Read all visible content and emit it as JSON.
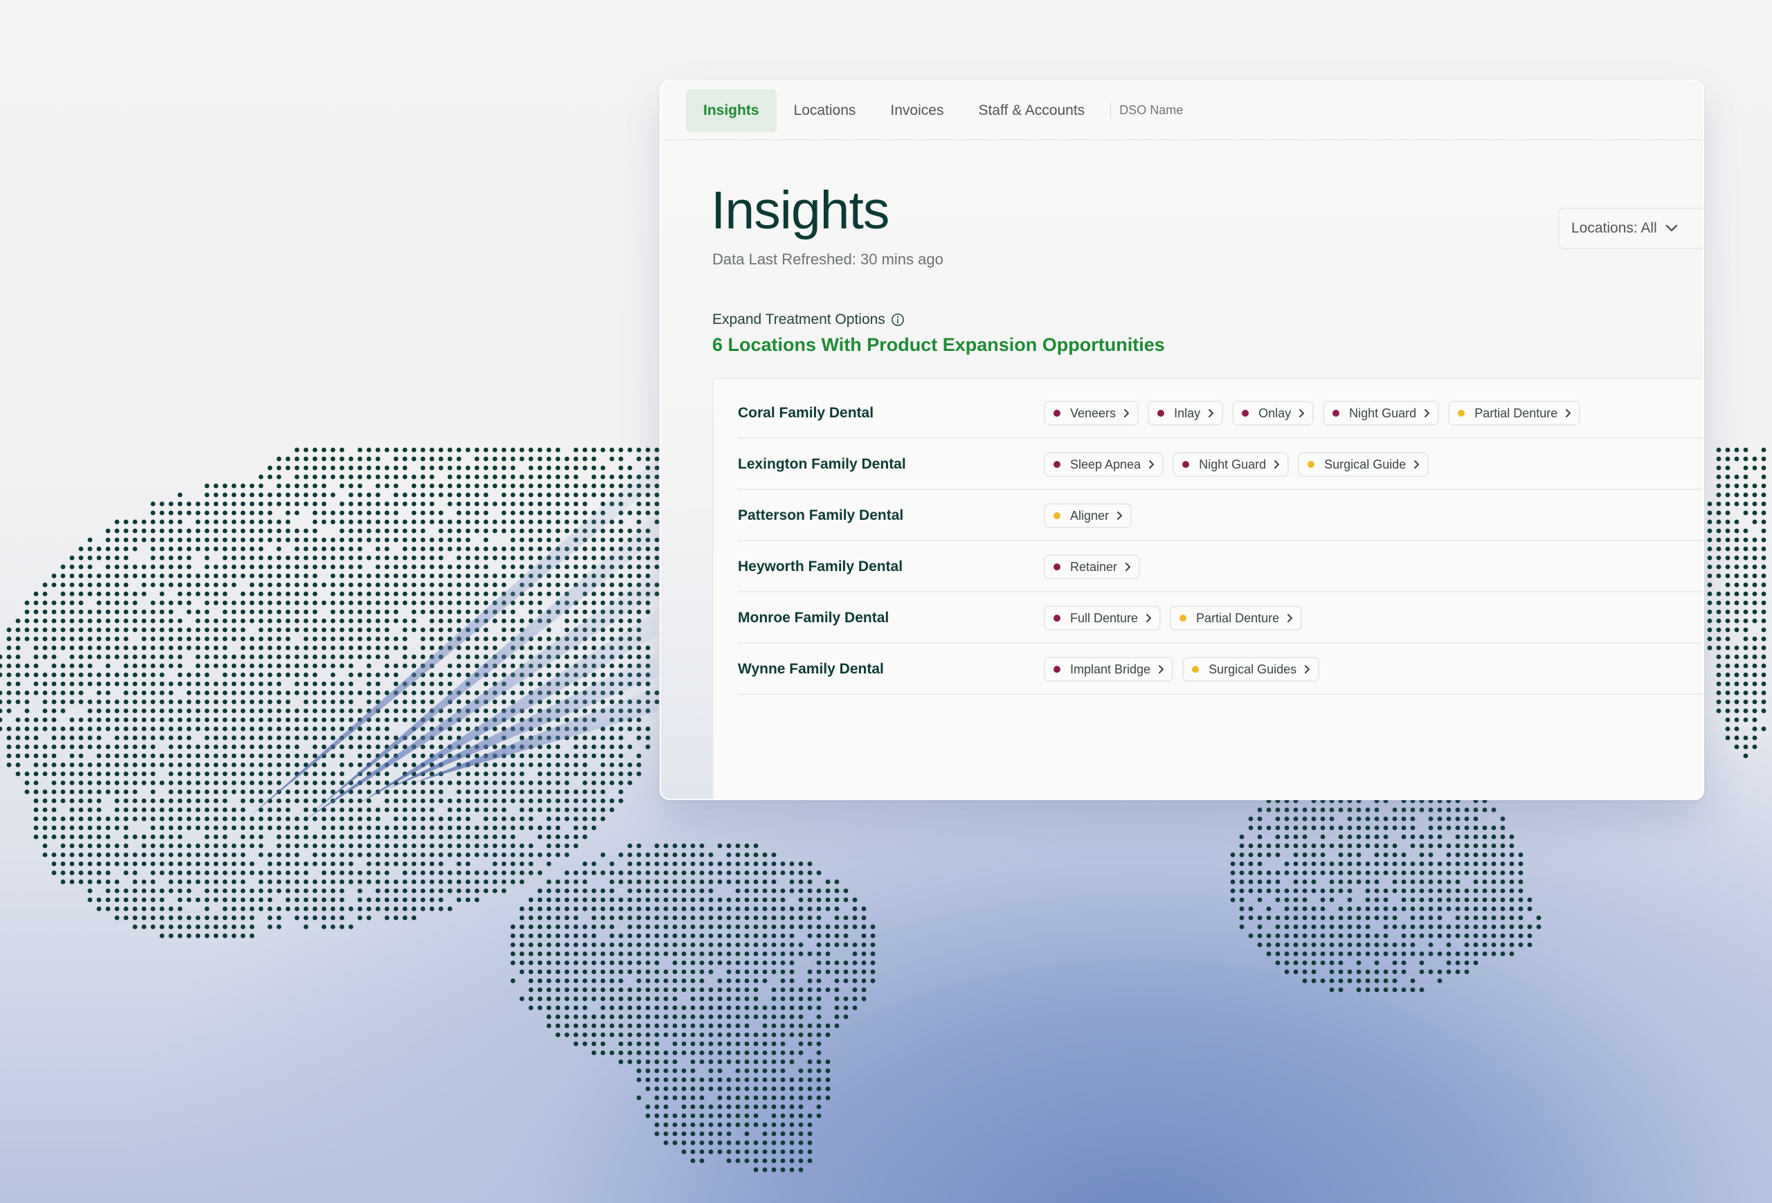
{
  "nav": {
    "tabs": [
      {
        "label": "Insights"
      },
      {
        "label": "Locations"
      },
      {
        "label": "Invoices"
      },
      {
        "label": "Staff & Accounts"
      }
    ],
    "dso_name": "DSO Name"
  },
  "page": {
    "title": "Insights",
    "refreshed": "Data Last Refreshed: 30 mins ago",
    "location_filter": "Locations: All",
    "section_label": "Expand Treatment Options",
    "section_heading": "6 Locations With Product Expansion Opportunities"
  },
  "colors": {
    "dot_crimson": "#8c1d4a",
    "dot_amber": "#f0b92c",
    "brand_green": "#1f8a34",
    "title_green": "#0c3a34"
  },
  "locations": [
    {
      "name": "Coral Family Dental",
      "products": [
        {
          "label": "Veneers",
          "dot": "crimson"
        },
        {
          "label": "Inlay",
          "dot": "crimson"
        },
        {
          "label": "Onlay",
          "dot": "crimson"
        },
        {
          "label": "Night Guard",
          "dot": "crimson"
        },
        {
          "label": "Partial Denture",
          "dot": "amber"
        }
      ]
    },
    {
      "name": "Lexington Family Dental",
      "products": [
        {
          "label": "Sleep Apnea",
          "dot": "crimson"
        },
        {
          "label": "Night Guard",
          "dot": "crimson"
        },
        {
          "label": "Surgical Guide",
          "dot": "amber"
        }
      ]
    },
    {
      "name": "Patterson Family Dental",
      "products": [
        {
          "label": "Aligner",
          "dot": "amber"
        }
      ]
    },
    {
      "name": "Heyworth Family Dental",
      "products": [
        {
          "label": "Retainer",
          "dot": "crimson"
        }
      ]
    },
    {
      "name": "Monroe Family Dental",
      "products": [
        {
          "label": "Full Denture",
          "dot": "crimson"
        },
        {
          "label": "Partial Denture",
          "dot": "amber"
        }
      ]
    },
    {
      "name": "Wynne Family Dental",
      "products": [
        {
          "label": "Implant Bridge",
          "dot": "crimson"
        },
        {
          "label": "Surgical Guides",
          "dot": "amber"
        }
      ]
    }
  ]
}
